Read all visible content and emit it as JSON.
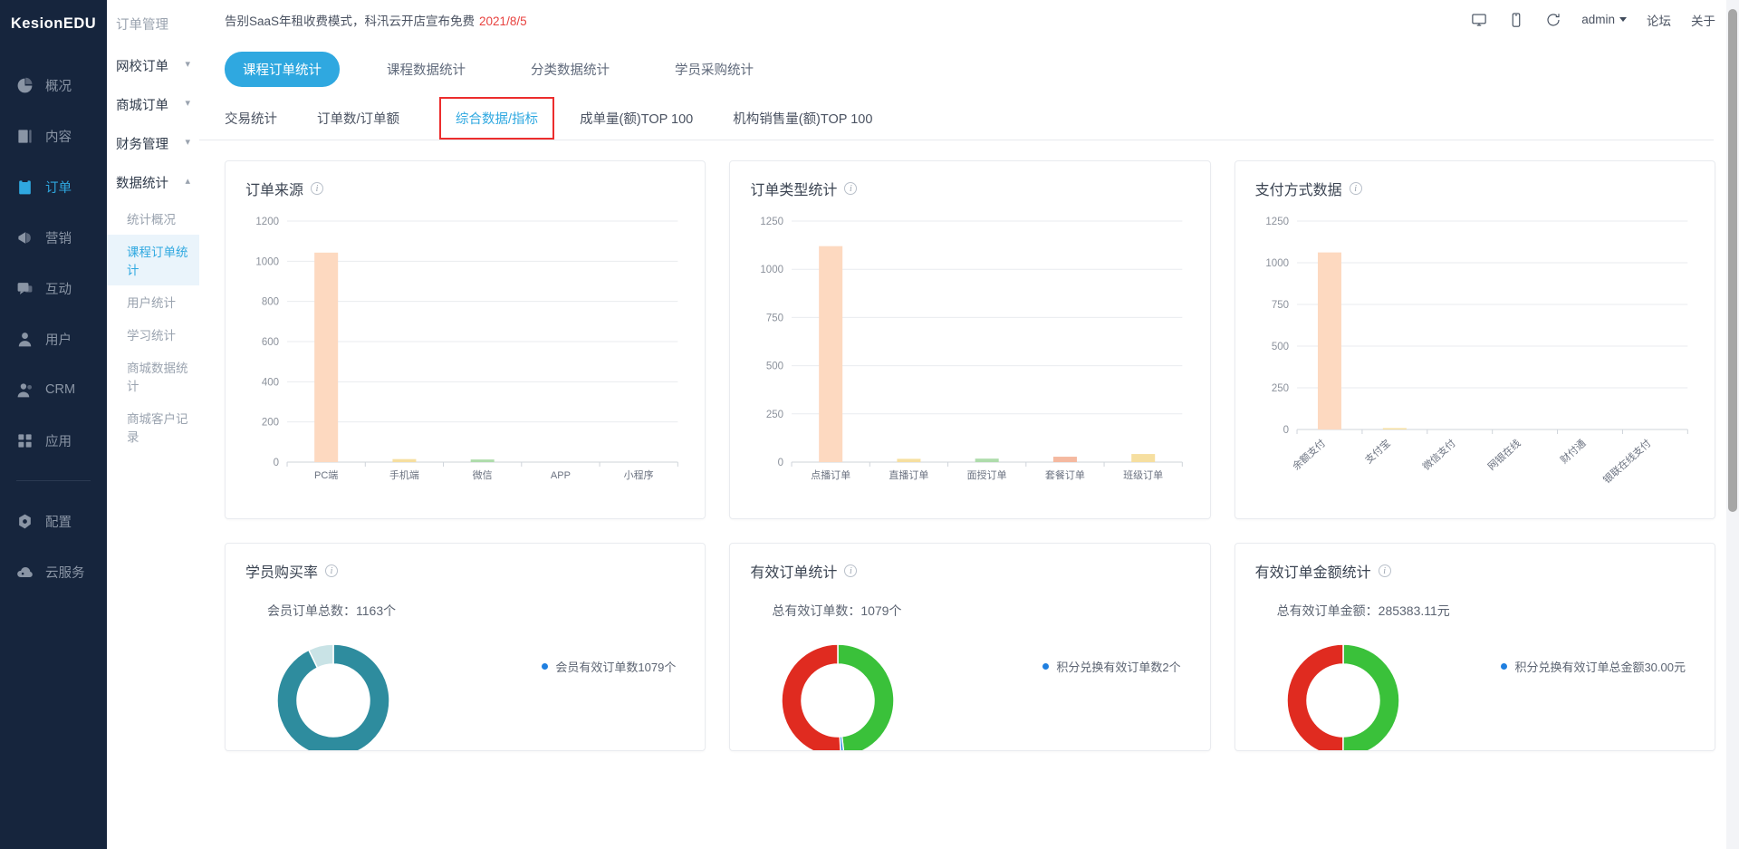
{
  "brand": {
    "name": "KesionEDU"
  },
  "sidebar": {
    "items": [
      {
        "label": "概况",
        "icon": "chart-pie-icon",
        "active": false
      },
      {
        "label": "内容",
        "icon": "document-icon",
        "active": false
      },
      {
        "label": "订单",
        "icon": "clipboard-icon",
        "active": true
      },
      {
        "label": "营销",
        "icon": "megaphone-icon",
        "active": false
      },
      {
        "label": "互动",
        "icon": "chat-icon",
        "active": false
      },
      {
        "label": "用户",
        "icon": "user-icon",
        "active": false
      },
      {
        "label": "CRM",
        "icon": "people-icon",
        "active": false
      },
      {
        "label": "应用",
        "icon": "grid-icon",
        "active": false
      }
    ],
    "footer_items": [
      {
        "label": "配置",
        "icon": "gear-icon"
      },
      {
        "label": "云服务",
        "icon": "cloud-icon"
      }
    ]
  },
  "submenu": {
    "title": "订单管理",
    "groups": [
      {
        "label": "网校订单",
        "expanded": false,
        "chevron": "chevron-down"
      },
      {
        "label": "商城订单",
        "expanded": false,
        "chevron": "chevron-down"
      },
      {
        "label": "财务管理",
        "expanded": false,
        "chevron": "chevron-down"
      },
      {
        "label": "数据统计",
        "expanded": true,
        "chevron": "chevron-up"
      }
    ],
    "leaves": [
      {
        "label": "统计概况",
        "active": false
      },
      {
        "label": "课程订单统计",
        "active": true
      },
      {
        "label": "用户统计",
        "active": false
      },
      {
        "label": "学习统计",
        "active": false
      },
      {
        "label": "商城数据统计",
        "active": false
      },
      {
        "label": "商城客户记录",
        "active": false
      }
    ]
  },
  "topbar": {
    "notice_text": "告别SaaS年租收费模式，科汛云开店宣布免费",
    "notice_date": "2021/8/5",
    "icons": [
      {
        "name": "desktop-icon"
      },
      {
        "name": "mobile-icon"
      },
      {
        "name": "refresh-icon"
      }
    ],
    "user": "admin",
    "links": [
      "论坛",
      "关于"
    ]
  },
  "pill_tabs": [
    {
      "label": "课程订单统计",
      "active": true
    },
    {
      "label": "课程数据统计",
      "active": false
    },
    {
      "label": "分类数据统计",
      "active": false
    },
    {
      "label": "学员采购统计",
      "active": false
    }
  ],
  "sub_tabs": [
    {
      "label": "交易统计",
      "active": false,
      "boxed": false
    },
    {
      "label": "订单数/订单额",
      "active": false,
      "boxed": false
    },
    {
      "label": "综合数据/指标",
      "active": true,
      "boxed": true
    },
    {
      "label": "成单量(额)TOP 100",
      "active": false,
      "boxed": false
    },
    {
      "label": "机构销售量(额)TOP 100",
      "active": false,
      "boxed": false
    }
  ],
  "colors": {
    "accent": "#2fa8e0",
    "danger": "#ec2d2d",
    "bar_peach": "#FDD9C0",
    "bar_yellow": "#F6DFA0",
    "bar_green": "#AEDCAB",
    "teal_dark": "#2E8C9E",
    "teal_light": "#C9E3E6",
    "red": "#e02b20",
    "green": "#3ac13a",
    "blue": "#1f7fe0"
  },
  "cards": [
    {
      "title": "订单来源",
      "info": "info-icon"
    },
    {
      "title": "订单类型统计",
      "info": "info-icon"
    },
    {
      "title": "支付方式数据",
      "info": "info-icon"
    }
  ],
  "bottom_cards": [
    {
      "title": "学员购买率",
      "info": "info-icon",
      "summary": "会员订单总数：1163个",
      "legend": [
        {
          "text": "会员有效订单数1079个",
          "color": "#1f7fe0"
        }
      ],
      "donut": {
        "segments": [
          {
            "value": 1079,
            "color": "#2E8C9E"
          },
          {
            "value": 84,
            "color": "#C9E3E6"
          }
        ]
      }
    },
    {
      "title": "有效订单统计",
      "info": "info-icon",
      "summary": "总有效订单数：1079个",
      "legend": [
        {
          "text": "积分兑换有效订单数2个",
          "color": "#1f7fe0"
        }
      ],
      "donut": {
        "segments": [
          {
            "value": 520,
            "color": "#3ac13a"
          },
          {
            "value": 10,
            "color": "#1f7fe0"
          },
          {
            "value": 549,
            "color": "#e02b20"
          }
        ]
      }
    },
    {
      "title": "有效订单金额统计",
      "info": "info-icon",
      "summary": "总有效订单金额：285383.11元",
      "legend": [
        {
          "text": "积分兑换有效订单总金额30.00元",
          "color": "#1f7fe0"
        }
      ],
      "donut": {
        "segments": [
          {
            "value": 540,
            "color": "#3ac13a"
          },
          {
            "value": 539,
            "color": "#e02b20"
          }
        ]
      }
    }
  ],
  "chart_data": [
    {
      "type": "bar",
      "title": "订单来源",
      "categories": [
        "PC端",
        "手机端",
        "微信",
        "APP",
        "小程序"
      ],
      "values": [
        1043,
        15,
        13,
        0,
        0
      ],
      "colors": [
        "#FDD9C0",
        "#F6DFA0",
        "#AEDCAB",
        "#FDD9C0",
        "#F6DFA0"
      ],
      "yticks": [
        0,
        200,
        400,
        600,
        800,
        1000,
        1200
      ],
      "ylim": [
        0,
        1200
      ],
      "xlabel": "",
      "ylabel": "",
      "grid": true,
      "rotate_labels": false
    },
    {
      "type": "bar",
      "title": "订单类型统计",
      "categories": [
        "点播订单",
        "直播订单",
        "面授订单",
        "套餐订单",
        "班级订单"
      ],
      "values": [
        1120,
        17,
        18,
        28,
        42
      ],
      "colors": [
        "#FDD9C0",
        "#F6DFA0",
        "#AEDCAB",
        "#F5B9A0",
        "#F6DFA0"
      ],
      "yticks": [
        0,
        250,
        500,
        750,
        1000,
        1250
      ],
      "ylim": [
        0,
        1250
      ],
      "xlabel": "",
      "ylabel": "",
      "grid": true,
      "rotate_labels": false
    },
    {
      "type": "bar",
      "title": "支付方式数据",
      "categories": [
        "余额支付",
        "支付宝",
        "微信支付",
        "网银在线",
        "财付通",
        "银联在线支付"
      ],
      "values": [
        1062,
        6,
        0,
        0,
        0,
        0
      ],
      "colors": [
        "#FDD9C0",
        "#F6DFA0",
        "#AEDCAB",
        "#FDD9C0",
        "#F6DFA0",
        "#AEDCAB"
      ],
      "yticks": [
        0,
        250,
        500,
        750,
        1000,
        1250
      ],
      "ylim": [
        0,
        1250
      ],
      "xlabel": "",
      "ylabel": "",
      "grid": true,
      "rotate_labels": true
    }
  ]
}
